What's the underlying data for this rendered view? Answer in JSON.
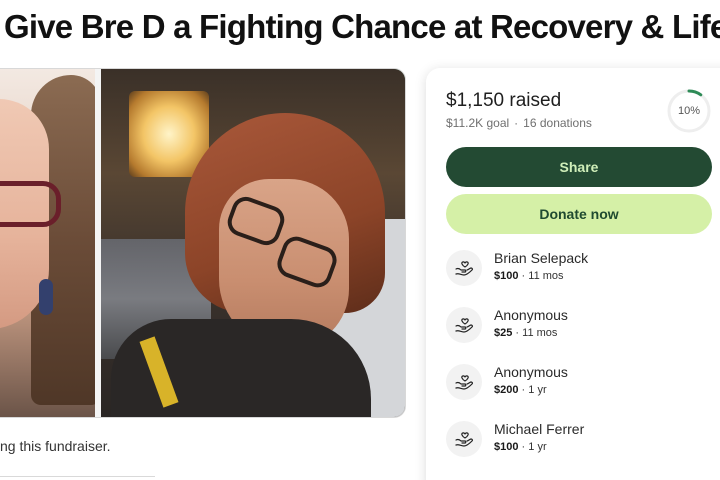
{
  "page": {
    "title": "Give Bre D a Fighting Chance at Recovery & Life",
    "story_snippet": "ng this fundraiser."
  },
  "fundraiser": {
    "raised_label": "$1,150 raised",
    "goal_label": "$11.2K goal",
    "separator": "·",
    "donations_label": "16 donations",
    "progress_percent": 10,
    "progress_label": "10%",
    "progress_color": "#2e8b57",
    "share_label": "Share",
    "donate_label": "Donate now"
  },
  "colors": {
    "share_bg": "#234a33",
    "donate_bg": "#d5f0a7",
    "photo_band": "#3c7a5f"
  },
  "donations": [
    {
      "name": "Brian Selepack",
      "amount": "$100",
      "time": "11 mos",
      "icon": "donation-hands-icon"
    },
    {
      "name": "Anonymous",
      "amount": "$25",
      "time": "11 mos",
      "icon": "donation-hands-icon"
    },
    {
      "name": "Anonymous",
      "amount": "$200",
      "time": "1 yr",
      "icon": "donation-hands-icon"
    },
    {
      "name": "Michael Ferrer",
      "amount": "$100",
      "time": "1 yr",
      "icon": "donation-hands-icon"
    }
  ]
}
